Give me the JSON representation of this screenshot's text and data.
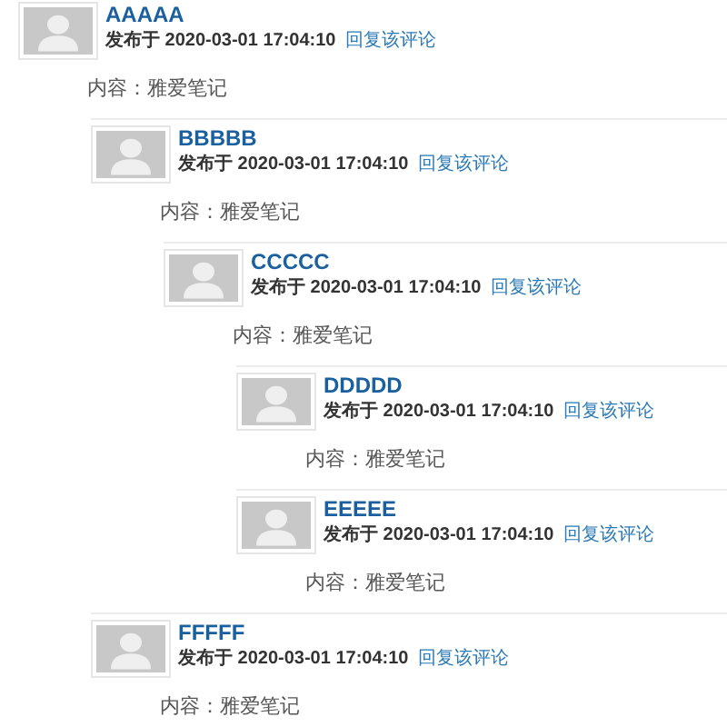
{
  "comments": [
    {
      "author": "AAAAA",
      "posted": "发布于 2020-03-01 17:04:10",
      "reply_link": "回复该评论",
      "content": "内容：雅爱笔记",
      "children": [
        {
          "author": "BBBBB",
          "posted": "发布于 2020-03-01 17:04:10",
          "reply_link": "回复该评论",
          "content": "内容：雅爱笔记",
          "children": [
            {
              "author": "CCCCC",
              "posted": "发布于 2020-03-01 17:04:10",
              "reply_link": "回复该评论",
              "content": "内容：雅爱笔记",
              "children": [
                {
                  "author": "DDDDD",
                  "posted": "发布于 2020-03-01 17:04:10",
                  "reply_link": "回复该评论",
                  "content": "内容：雅爱笔记"
                },
                {
                  "author": "EEEEE",
                  "posted": "发布于 2020-03-01 17:04:10",
                  "reply_link": "回复该评论",
                  "content": "内容：雅爱笔记"
                }
              ]
            }
          ]
        },
        {
          "author": "FFFFF",
          "posted": "发布于 2020-03-01 17:04:10",
          "reply_link": "回复该评论",
          "content": "内容：雅爱笔记"
        }
      ]
    }
  ]
}
